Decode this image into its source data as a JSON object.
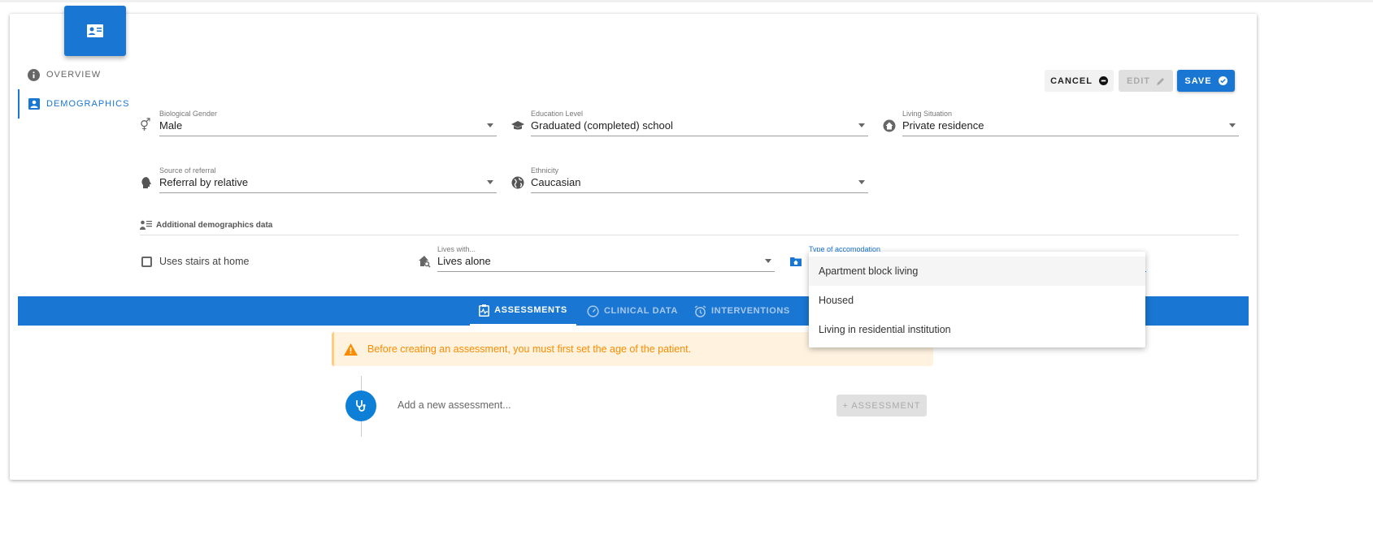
{
  "sidebar": {
    "items": [
      {
        "label": "OVERVIEW",
        "icon": "info-icon",
        "active": false
      },
      {
        "label": "DEMOGRAPHICS",
        "icon": "person-badge-icon",
        "active": true
      }
    ]
  },
  "toolbar": {
    "cancel_label": "CANCEL",
    "edit_label": "EDIT",
    "save_label": "SAVE"
  },
  "fields": {
    "gender": {
      "label": "Biological Gender",
      "value": "Male"
    },
    "education": {
      "label": "Education Level",
      "value": "Graduated (completed) school"
    },
    "living": {
      "label": "Living Situation",
      "value": "Private residence"
    },
    "referral": {
      "label": "Source of referral",
      "value": "Referral by relative"
    },
    "ethnicity": {
      "label": "Ethnicity",
      "value": "Caucasian"
    }
  },
  "additional": {
    "title": "Additional demographics data",
    "stairs_label": "Uses stairs at home",
    "stairs_checked": false,
    "lives_with": {
      "label": "Lives with...",
      "value": "Lives alone"
    },
    "accommodation": {
      "label": "Type of accomodation",
      "options": [
        "Apartment block living",
        "Housed",
        "Living in residential institution"
      ],
      "highlighted": "Apartment block living"
    }
  },
  "tabs": [
    {
      "label": "ASSESSMENTS",
      "active": true
    },
    {
      "label": "CLINICAL DATA",
      "active": false
    },
    {
      "label": "INTERVENTIONS",
      "active": false
    }
  ],
  "alert": {
    "text": "Before creating an assessment, you must first set the age of the patient."
  },
  "assessment": {
    "placeholder": "Add a new assessment...",
    "button_label": "+ ASSESSMENT"
  },
  "colors": {
    "primary": "#1976d2",
    "warning": "#ff9800",
    "warning_bg": "#fff3e0"
  }
}
